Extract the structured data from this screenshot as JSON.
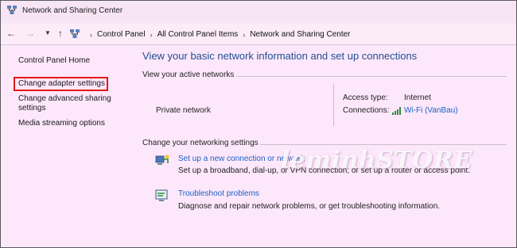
{
  "window": {
    "title": "Network and Sharing Center"
  },
  "address_bar": {
    "crumbs": [
      "Control Panel",
      "All Control Panel Items",
      "Network and Sharing Center"
    ]
  },
  "sidebar": {
    "items": [
      {
        "label": "Control Panel Home"
      },
      {
        "label": "Change adapter settings",
        "highlighted": true
      },
      {
        "label": "Change advanced sharing settings"
      },
      {
        "label": "Media streaming options"
      }
    ],
    "highlight_color": "#e11919"
  },
  "main": {
    "heading": "View your basic network information and set up connections",
    "active_networks_label": "View your active networks",
    "network_name": "Private network",
    "access_type_label": "Access type:",
    "access_type_value": "Internet",
    "connections_label": "Connections:",
    "connections_value": "Wi-Fi (VanBau)",
    "change_settings_label": "Change your networking settings",
    "tasks": [
      {
        "icon": "new-connection-icon",
        "link": "Set up a new connection or network",
        "description": "Set up a broadband, dial-up, or VPN connection; or set up a router or access point."
      },
      {
        "icon": "troubleshoot-icon",
        "link": "Troubleshoot problems",
        "description": "Diagnose and repair network problems, or get troubleshooting information."
      }
    ]
  },
  "watermark": "leminhSTORE",
  "colors": {
    "background": "#fde7fb",
    "link": "#1a62c4",
    "heading": "#1f4f8f"
  }
}
